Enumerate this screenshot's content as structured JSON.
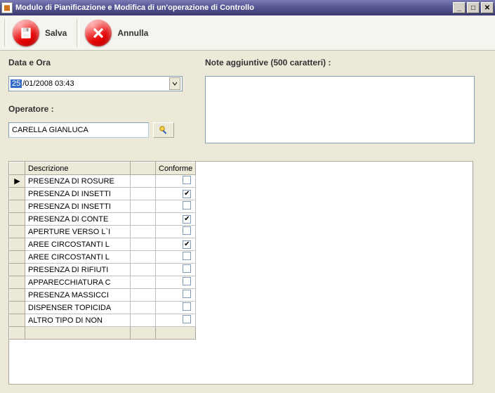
{
  "window": {
    "title": "Modulo di Pianificazione e Modifica di un'operazione di Controllo"
  },
  "toolbar": {
    "save_label": "Salva",
    "cancel_label": "Annulla"
  },
  "labels": {
    "date": "Data e Ora",
    "operator": "Operatore :",
    "notes": "Note aggiuntive (500 caratteri) :"
  },
  "date": {
    "selected_part": "25",
    "rest": "/01/2008 03:43"
  },
  "operator": {
    "value": "CARELLA GIANLUCA"
  },
  "notes": {
    "value": ""
  },
  "grid": {
    "headers": {
      "desc": "Descrizione",
      "conforme": "Conforme"
    },
    "rows": [
      {
        "desc": "PRESENZA DI ROSURE",
        "conforme": false,
        "current": true
      },
      {
        "desc": "PRESENZA DI INSETTI",
        "conforme": true
      },
      {
        "desc": "PRESENZA DI INSETTI",
        "conforme": false
      },
      {
        "desc": "PRESENZA DI CONTE",
        "conforme": true
      },
      {
        "desc": "APERTURE VERSO L`I",
        "conforme": false
      },
      {
        "desc": "AREE CIRCOSTANTI L",
        "conforme": true
      },
      {
        "desc": "AREE CIRCOSTANTI L",
        "conforme": false
      },
      {
        "desc": "PRESENZA DI RIFIUTI",
        "conforme": false
      },
      {
        "desc": "APPARECCHIATURA C",
        "conforme": false
      },
      {
        "desc": "PRESENZA MASSICCI",
        "conforme": false
      },
      {
        "desc": "DISPENSER TOPICIDA",
        "conforme": false
      },
      {
        "desc": "ALTRO TIPO DI NON",
        "conforme": false
      }
    ]
  }
}
